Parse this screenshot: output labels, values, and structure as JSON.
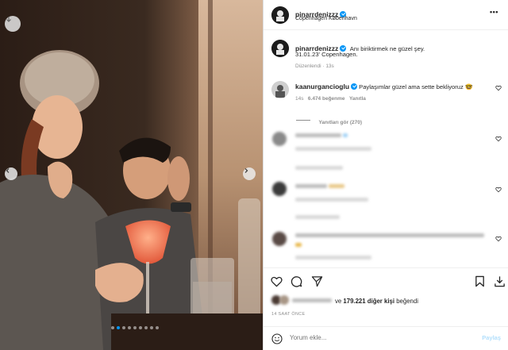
{
  "post": {
    "author": "pinarrdenizzz",
    "location": "Copenhagen København",
    "caption_line1": "Anı biriktirmek ne güzel şey.",
    "caption_line2": "31.01.23' Copenhagen.",
    "edited": "Düzenlendi",
    "edited_time": "13s"
  },
  "comments": [
    {
      "user": "kaanurgancioglu",
      "text": "Paylaşımlar güzel ama sette bekliyoruz",
      "emoji": "🤓",
      "time": "14s",
      "likes": "6.474 beğenme",
      "reply": "Yanıtla",
      "view_replies": "Yanıtları gör (270)"
    }
  ],
  "likes_text_suffix": "ve",
  "likes_count": "179.221 diğer kişi",
  "likes_verb": "beğendi",
  "timestamp": "14 SAAT ÖNCE",
  "comment_placeholder": "Yorum ekle...",
  "share_label": "Paylaş",
  "colors": {
    "verified": "#0095f6",
    "share_disabled": "#b2dffc",
    "muted": "#8e8e8e"
  },
  "icons": [
    "download-icon",
    "chevron-left-icon",
    "chevron-right-icon",
    "verified-icon",
    "more-icon",
    "heart-icon",
    "comment-icon",
    "share-icon",
    "bookmark-icon",
    "emoji-icon"
  ]
}
